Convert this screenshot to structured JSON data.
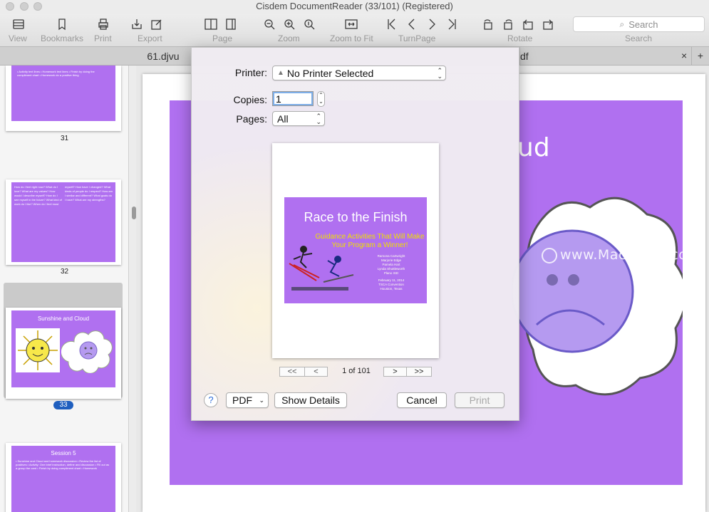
{
  "window": {
    "title": "Cisdem DocumentReader (33/101) (Registered)"
  },
  "toolbar": {
    "view": "View",
    "bookmarks": "Bookmarks",
    "print": "Print",
    "export": "Export",
    "page": "Page",
    "zoom": "Zoom",
    "zoom_to_fit": "Zoom to Fit",
    "turn_page": "TurnPage",
    "rotate": "Rotate",
    "search_label": "Search",
    "search_placeholder": "Search"
  },
  "tabs": {
    "tab1": "61.djvu",
    "tab2": "df",
    "close": "×",
    "add": "+"
  },
  "sidebar": {
    "pages": [
      "31",
      "32",
      "33"
    ],
    "thumb33_title": "Sunshine and Cloud",
    "thumb34_title": "Session 5"
  },
  "document": {
    "slide_title_partial": "ud"
  },
  "watermark": "www.MacDown.com",
  "print_dialog": {
    "printer_label": "Printer:",
    "printer_value": "No Printer Selected",
    "copies_label": "Copies:",
    "copies_value": "1",
    "pages_label": "Pages:",
    "pages_value": "All",
    "preview": {
      "title": "Race to the Finish",
      "subtitle": "Guidance Activities That Will Make Your Program a Winner!",
      "authors": [
        "Ramona Cartwright",
        "Marjorie Edge",
        "Pamela Hart",
        "Lynda Shuttleworth",
        "Plano ISD"
      ],
      "date_lines": [
        "February 11, 2014",
        "TSCA Convention",
        "Houston, Texas"
      ]
    },
    "pager": {
      "first": "<<",
      "prev": "<",
      "status": "1 of 101",
      "next": ">",
      "last": ">>"
    },
    "help": "?",
    "pdf": "PDF",
    "show_details": "Show Details",
    "cancel": "Cancel",
    "print": "Print"
  }
}
